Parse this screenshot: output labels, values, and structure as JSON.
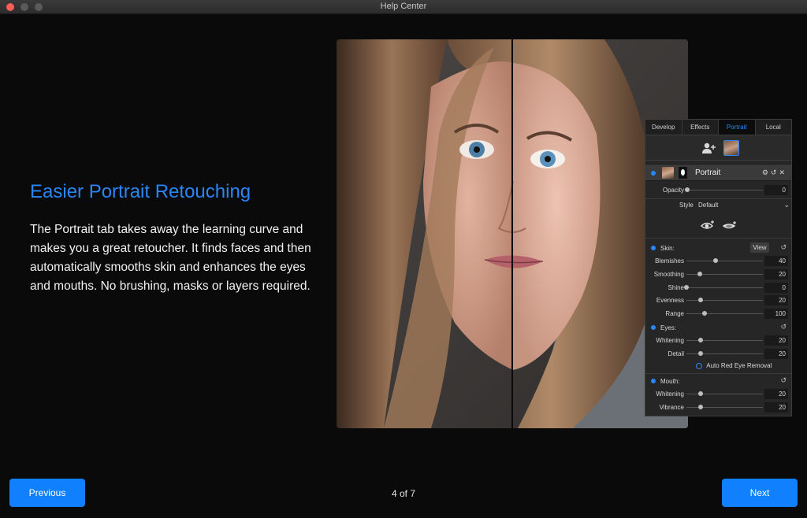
{
  "window": {
    "title": "Help Center"
  },
  "slide": {
    "heading": "Easier Portrait Retouching",
    "body": "The Portrait tab takes away the learning curve and makes you a great retoucher. It finds faces and then automatically smooths skin and enhances the eyes and mouths. No brushing, masks or layers required."
  },
  "panel": {
    "tabs": [
      "Develop",
      "Effects",
      "Portrait",
      "Local"
    ],
    "active_tab": "Portrait",
    "layer_name": "Portrait",
    "opacity": {
      "label": "Opacity",
      "value": "0"
    },
    "style": {
      "label": "Style",
      "value": "Default"
    },
    "skin": {
      "label": "Skin:",
      "view_label": "View",
      "sliders": [
        {
          "label": "Blemishes",
          "value": "40"
        },
        {
          "label": "Smoothing",
          "value": "20"
        },
        {
          "label": "Shine",
          "value": "0"
        },
        {
          "label": "Evenness",
          "value": "20"
        },
        {
          "label": "Range",
          "value": "100"
        }
      ]
    },
    "eyes": {
      "label": "Eyes:",
      "sliders": [
        {
          "label": "Whitening",
          "value": "20"
        },
        {
          "label": "Detail",
          "value": "20"
        }
      ],
      "red_eye_label": "Auto Red Eye Removal"
    },
    "mouth": {
      "label": "Mouth:",
      "sliders": [
        {
          "label": "Whitening",
          "value": "20"
        },
        {
          "label": "Vibrance",
          "value": "20"
        }
      ]
    }
  },
  "pager": {
    "text": "4 of 7"
  },
  "nav": {
    "previous": "Previous",
    "next": "Next"
  },
  "colors": {
    "accent": "#1080ff",
    "heading": "#2a86f7",
    "background": "#0a0a0a"
  }
}
